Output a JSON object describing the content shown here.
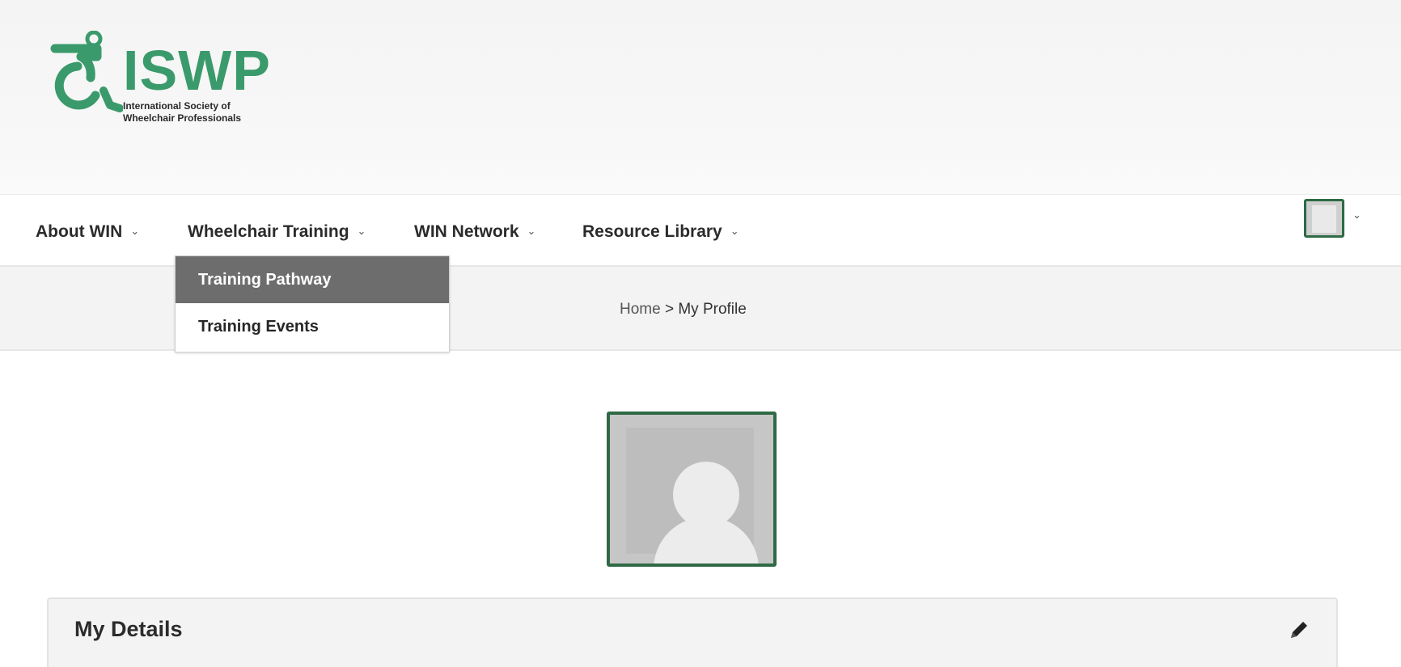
{
  "brand": {
    "logo_word": "ISWP",
    "logo_subtitle_line1": "International Society of",
    "logo_subtitle_line2": "Wheelchair Professionals",
    "accent_color": "#3a9a6b",
    "frame_color": "#2e6a45"
  },
  "nav": {
    "items": [
      {
        "label": "About WIN",
        "icon": "chevron-down-icon"
      },
      {
        "label": "Wheelchair Training",
        "icon": "chevron-down-icon"
      },
      {
        "label": "WIN Network",
        "icon": "chevron-down-icon"
      },
      {
        "label": "Resource Library",
        "icon": "chevron-down-icon"
      }
    ],
    "chevron": "⌄"
  },
  "dropdown": {
    "items": [
      {
        "label": "Training Pathway",
        "state": "highlighted"
      },
      {
        "label": "Training Events",
        "state": "normal"
      }
    ]
  },
  "user_menu": {
    "avatar_icon": "user-avatar-icon",
    "chevron": "⌄"
  },
  "breadcrumb": {
    "home": "Home",
    "separator": " > ",
    "current": "My Profile"
  },
  "profile": {
    "photo_icon": "default-user-silhouette-icon"
  },
  "details": {
    "title": "My Details",
    "edit_icon": "pencil-icon"
  }
}
